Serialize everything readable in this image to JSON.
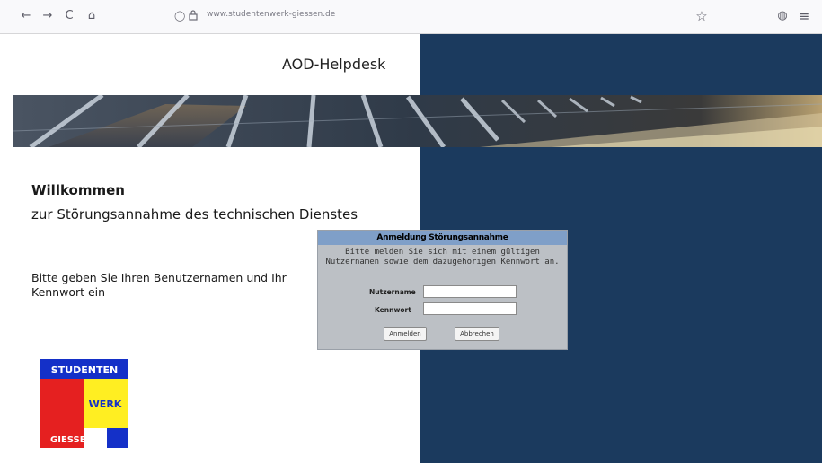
{
  "browser": {
    "back_icon": "←",
    "forward_icon": "→",
    "reload_icon": "C",
    "home_icon": "⌂",
    "shield_icon": "◯",
    "lock_icon": "🔒",
    "url": "www.studentenwerk-giessen.de",
    "bookmark_icon": "☆",
    "account_icon": "◍",
    "menu_icon": "≡"
  },
  "header": {
    "title": "AOD-Helpdesk"
  },
  "welcome": {
    "heading": "Willkommen",
    "subtitle": "zur Störungsannahme des technischen Dienstes",
    "instruction": "Bitte geben Sie Ihren Benutzernamen und Ihr Kennwort ein"
  },
  "login": {
    "title": "Anmeldung Störungsannahme",
    "message": "Bitte melden Sie sich mit einem gültigen Nutzernamen sowie dem dazugehörigen Kennwort an.",
    "username_label": "Nutzername",
    "password_label": "Kennwort",
    "username_value": "",
    "password_value": "",
    "submit_label": "Anmelden",
    "cancel_label": "Abbrechen"
  },
  "logo": {
    "line1": "STUDENTEN",
    "line2": "WERK",
    "line3": "GIESSEN"
  },
  "colors": {
    "panel": "#1b3a5e",
    "login_header": "#7f9fc8",
    "logo_blue": "#1430c8",
    "logo_red": "#e52020",
    "logo_yellow": "#ffee22"
  }
}
